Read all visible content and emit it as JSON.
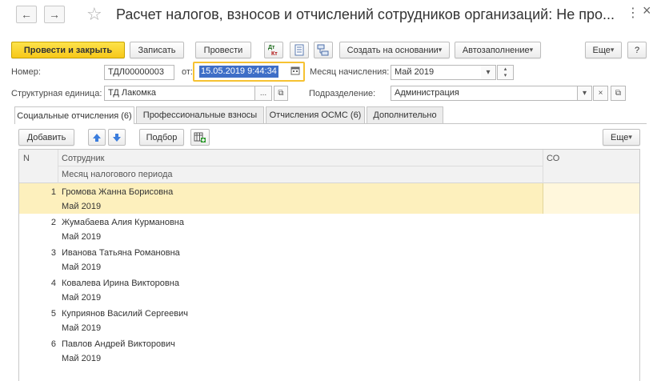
{
  "window": {
    "title": "Расчет налогов, взносов и отчислений сотрудников организаций: Не про...",
    "back_icon": "←",
    "forward_icon": "→",
    "star_icon": "☆",
    "more_icon": "⋮",
    "close_icon": "×"
  },
  "toolbar": {
    "post_close": "Провести и закрыть",
    "save": "Записать",
    "post": "Провести",
    "dt_kt_top": "Дт",
    "dt_kt_bottom": "Кт",
    "create_based": "Создать на основании",
    "autofill": "Автозаполнение",
    "more": "Еще",
    "help": "?"
  },
  "form": {
    "number_label": "Номер:",
    "number_value": "ТДЛ00000003",
    "date_label": "от:",
    "date_value": "15.05.2019  9:44:34",
    "month_label": "Месяц начисления:",
    "month_value": "Май 2019",
    "struct_label": "Структурная единица:",
    "struct_value": "ТД Лакомка",
    "dept_label": "Подразделение:",
    "dept_value": "Администрация"
  },
  "tabs": [
    {
      "label": "Социальные отчисления (6)"
    },
    {
      "label": "Профессиональные взносы"
    },
    {
      "label": "Отчисления ОСМС (6)"
    },
    {
      "label": "Дополнительно"
    }
  ],
  "table_toolbar": {
    "add": "Добавить",
    "select": "Подбор",
    "more": "Еще"
  },
  "table": {
    "headers": {
      "n": "N",
      "employee": "Сотрудник",
      "period": "Месяц налогового периода",
      "so": "СО"
    },
    "rows": [
      {
        "n": "1",
        "employee": "Громова Жанна Борисовна",
        "period": "Май 2019"
      },
      {
        "n": "2",
        "employee": "Жумабаева Алия Курмановна",
        "period": "Май 2019"
      },
      {
        "n": "3",
        "employee": "Иванова Татьяна Романовна",
        "period": "Май 2019"
      },
      {
        "n": "4",
        "employee": "Ковалева Ирина Викторовна",
        "period": "Май 2019"
      },
      {
        "n": "5",
        "employee": "Куприянов Василий Сергеевич",
        "period": "Май 2019"
      },
      {
        "n": "6",
        "employee": "Павлов Андрей Викторович",
        "period": "Май 2019"
      }
    ]
  }
}
